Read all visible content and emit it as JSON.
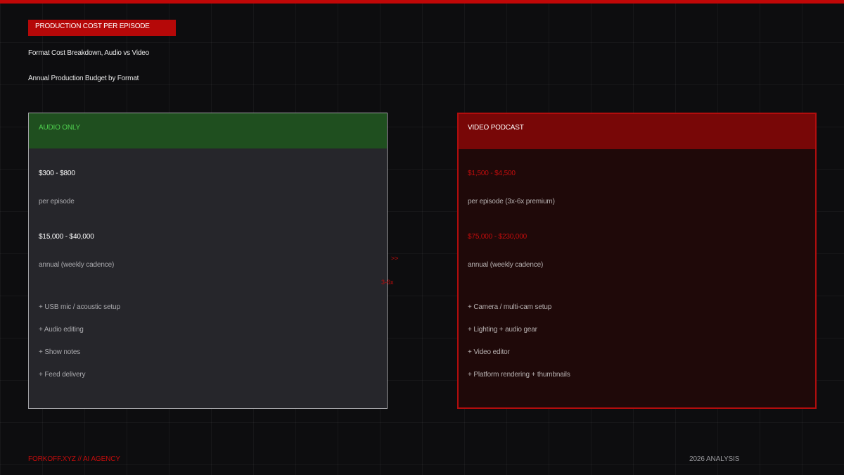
{
  "header": {
    "tag": "PRODUCTION COST PER EPISODE",
    "subtitle_1": "Format Cost Breakdown, Audio vs Video",
    "subtitle_2": "Annual Production Budget by Format"
  },
  "cards": {
    "audio": {
      "title": "AUDIO ONLY",
      "episode_cost": "$300 - $800",
      "episode_note": "per episode",
      "annual_cost": "$15,000 - $40,000",
      "annual_note": "annual (weekly cadence)",
      "items": [
        "+ USB mic / acoustic setup",
        "+ Audio editing",
        "+ Show notes",
        "+ Feed delivery"
      ]
    },
    "video": {
      "title": "VIDEO PODCAST",
      "episode_cost": "$1,500 - $4,500",
      "episode_note": "per episode (3x-6x premium)",
      "annual_cost": "$75,000 - $230,000",
      "annual_note": "annual (weekly cadence)",
      "items": [
        "+ Camera / multi-cam setup",
        "+ Lighting + audio gear",
        "+ Video editor",
        "+ Platform rendering + thumbnails"
      ]
    }
  },
  "connector": {
    "arrow": ">>",
    "multiplier": "3-6x"
  },
  "footer": {
    "left": "FORKOFF.XYZ // AI AGENCY",
    "right": "2026 ANALYSIS"
  },
  "colors": {
    "accent_red": "#c00707",
    "audio_green": "#1f4f1f",
    "audio_green_text": "#4fd04f",
    "video_red_header": "#780707",
    "background": "#0d0d0f"
  }
}
